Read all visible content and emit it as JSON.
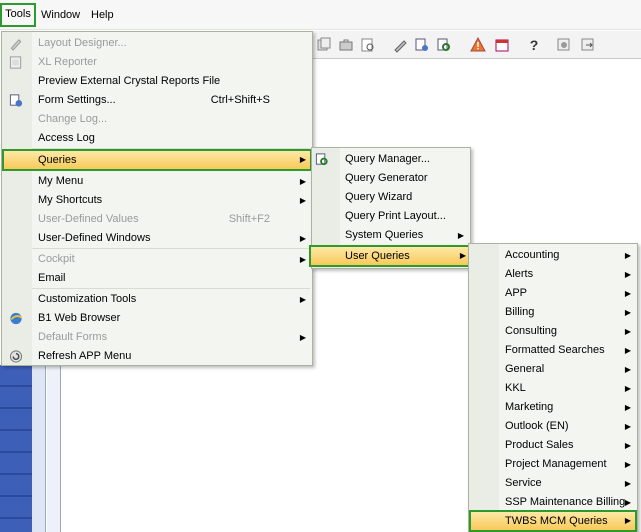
{
  "menubar": {
    "tools": "Tools",
    "window": "Window",
    "help": "Help"
  },
  "toolbar_icons": [
    "copy-icon",
    "briefcase-icon",
    "print-preview-icon",
    "pen-icon",
    "form-settings-icon",
    "query-icon",
    "warning-icon",
    "calendar-icon",
    "help-icon",
    "settings-icon",
    "export-icon"
  ],
  "tools_menu": {
    "items": [
      {
        "label": "Layout Designer...",
        "disabled": true,
        "icon": "pencil-icon"
      },
      {
        "label": "XL Reporter",
        "disabled": true,
        "icon": "report-icon"
      },
      {
        "label": "Preview External Crystal Reports File"
      },
      {
        "label": "Form Settings...",
        "shortcut": "Ctrl+Shift+S",
        "icon": "form-settings-icon"
      },
      {
        "label": "Change Log...",
        "disabled": true
      },
      {
        "label": "Access Log"
      },
      {
        "label": "Queries",
        "submenu": true,
        "highlighted": true
      },
      {
        "label": "My Menu",
        "submenu": true
      },
      {
        "label": "My Shortcuts",
        "submenu": true
      },
      {
        "label": "User-Defined Values",
        "shortcut": "Shift+F2",
        "disabled": true
      },
      {
        "label": "User-Defined Windows",
        "submenu": true
      },
      {
        "label": "Cockpit",
        "submenu": true,
        "disabled": true
      },
      {
        "label": "Email"
      },
      {
        "label": "Customization Tools",
        "submenu": true
      },
      {
        "label": "B1 Web Browser",
        "icon": "browser-icon"
      },
      {
        "label": "Default Forms",
        "submenu": true,
        "disabled": true
      },
      {
        "label": "Refresh APP Menu",
        "icon": "refresh-icon"
      }
    ]
  },
  "queries_menu": {
    "items": [
      {
        "label": "Query Manager...",
        "icon": "query-manager-icon"
      },
      {
        "label": "Query Generator"
      },
      {
        "label": "Query Wizard"
      },
      {
        "label": "Query Print Layout..."
      },
      {
        "label": "System Queries",
        "submenu": true
      },
      {
        "label": "User Queries",
        "submenu": true,
        "highlighted": true
      }
    ]
  },
  "user_queries_menu": {
    "items": [
      {
        "label": "Accounting"
      },
      {
        "label": "Alerts"
      },
      {
        "label": "APP"
      },
      {
        "label": "Billing"
      },
      {
        "label": "Consulting"
      },
      {
        "label": "Formatted Searches"
      },
      {
        "label": "General"
      },
      {
        "label": "KKL"
      },
      {
        "label": "Marketing"
      },
      {
        "label": "Outlook (EN)"
      },
      {
        "label": "Product Sales"
      },
      {
        "label": "Project Management"
      },
      {
        "label": "Service"
      },
      {
        "label": "SSP Maintenance Billing"
      },
      {
        "label": "TWBS MCM Queries",
        "highlighted": true
      }
    ]
  },
  "colors": {
    "highlight_border": "#2e9a2e",
    "highlight_fill": "#f8c95a",
    "menu_bg": "#f3f6f0",
    "disabled_text": "#9a9a9a"
  }
}
